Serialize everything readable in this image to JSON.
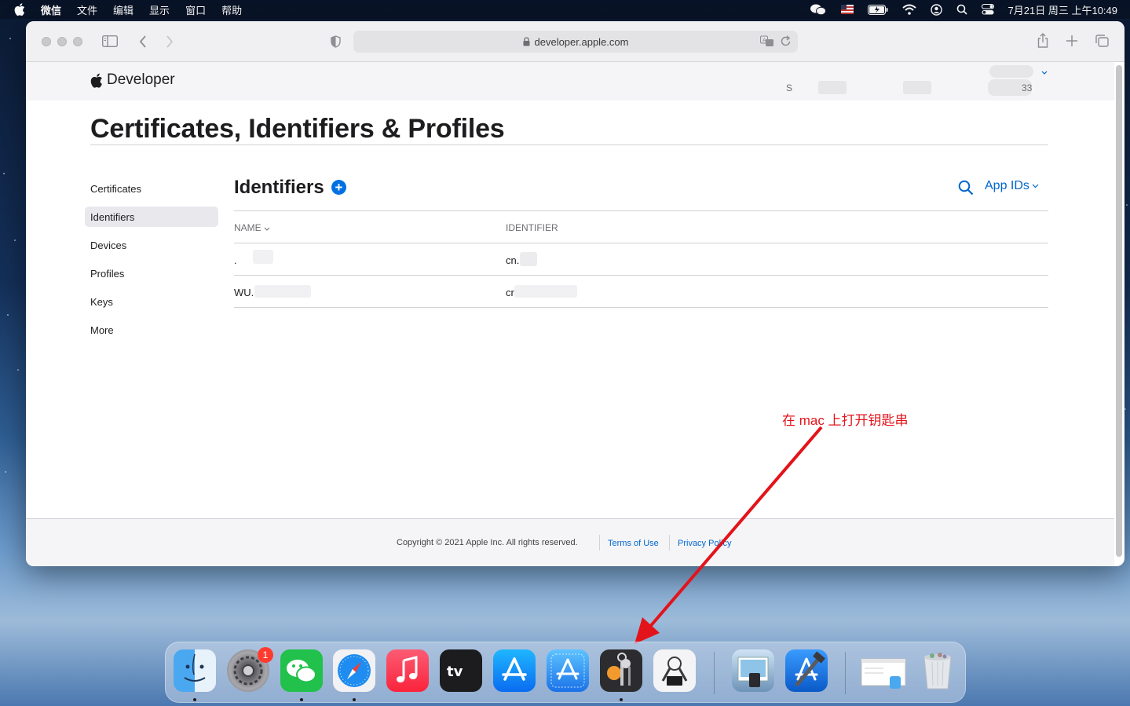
{
  "menubar": {
    "app_name": "微信",
    "menus": [
      "文件",
      "编辑",
      "显示",
      "窗口",
      "帮助"
    ],
    "clock": "7月21日 周三 上午10:49"
  },
  "browser": {
    "url": "developer.apple.com"
  },
  "site": {
    "brand": "Developer",
    "account_initial": "S",
    "account_suffix": "33"
  },
  "page": {
    "title": "Certificates, Identifiers & Profiles"
  },
  "sidebar": {
    "items": [
      {
        "label": "Certificates"
      },
      {
        "label": "Identifiers"
      },
      {
        "label": "Devices"
      },
      {
        "label": "Profiles"
      },
      {
        "label": "Keys"
      },
      {
        "label": "More"
      }
    ],
    "active": "Identifiers"
  },
  "section": {
    "title": "Identifiers",
    "filter_label": "App IDs"
  },
  "table": {
    "headers": {
      "name": "NAME",
      "identifier": "IDENTIFIER"
    },
    "rows": [
      {
        "name": ".",
        "identifier": "cn."
      },
      {
        "name": "WU.",
        "identifier": "cr"
      }
    ]
  },
  "footer": {
    "copyright": "Copyright © 2021 Apple Inc. All rights reserved.",
    "terms": "Terms of Use",
    "privacy": "Privacy Policy"
  },
  "annotation": {
    "text": "在 mac 上打开钥匙串",
    "color": "#e3131b"
  },
  "dock": {
    "apps": [
      "finder-icon",
      "system-preferences-icon",
      "wechat-icon",
      "safari-icon",
      "music-icon",
      "apple-tv-icon",
      "app-store-icon",
      "xcode-app-store-icon",
      "keychain-access-icon",
      "system-information-icon",
      "preview-icon",
      "xcode-icon",
      "finder-window-icon",
      "trash-icon"
    ],
    "system_preferences_badge": "1"
  },
  "colors": {
    "accent": "#0071e3",
    "link": "#0066cc",
    "annotation": "#e3131b"
  }
}
